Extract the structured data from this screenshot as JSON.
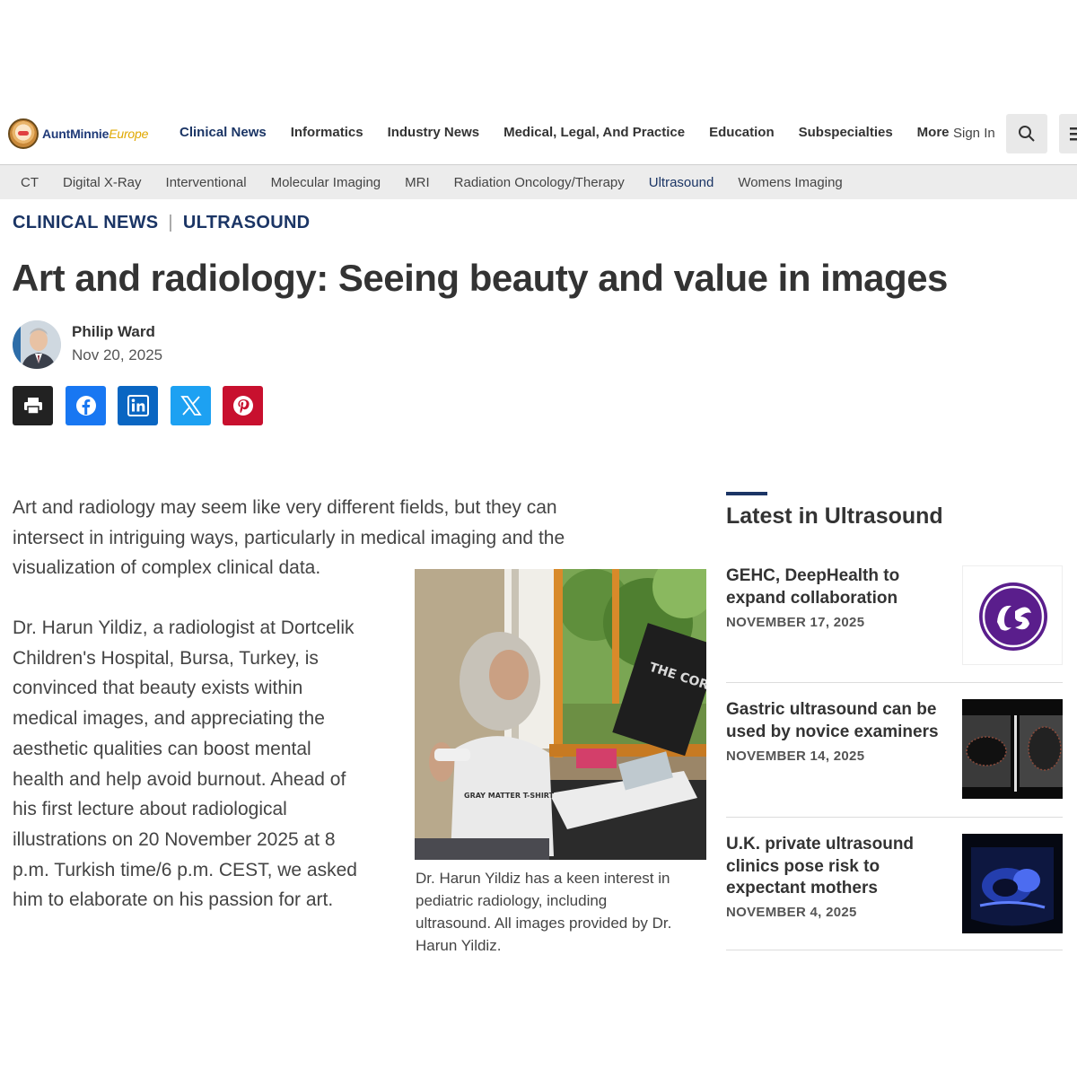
{
  "logo": {
    "brand": "AuntMinnie",
    "region": "Europe"
  },
  "nav": {
    "items": [
      "Clinical News",
      "Informatics",
      "Industry News",
      "Medical, Legal, And Practice",
      "Education",
      "Subspecialties",
      "More"
    ],
    "sign_in": "Sign In"
  },
  "subnav": {
    "items": [
      "CT",
      "Digital X-Ray",
      "Interventional",
      "Molecular Imaging",
      "MRI",
      "Radiation Oncology/Therapy",
      "Ultrasound",
      "Womens Imaging"
    ]
  },
  "breadcrumb": {
    "section": "CLINICAL NEWS",
    "separator": "|",
    "topic": "ULTRASOUND"
  },
  "article": {
    "title": "Art and radiology: Seeing beauty and value in images",
    "author": "Philip Ward",
    "date": "Nov 20, 2025",
    "intro_lines": [
      "Art and radiology may seem like very different fields, but they can",
      "intersect in intriguing ways, particularly in medical imaging and the",
      "visualization of complex clinical data."
    ],
    "para2_lines": [
      "Dr. Harun Yildiz, a radiologist at Dortcelik",
      "Children's Hospital, Bursa, Turkey, is",
      "convinced that beauty exists within",
      "medical images, and appreciating the",
      "aesthetic qualities can boost mental",
      "health and help avoid burnout. Ahead of",
      "his first lecture about radiological",
      "illustrations on 20 November 2025 at 8",
      "p.m. Turkish time/6 p.m. CEST, we asked",
      "him to elaborate on his passion for art."
    ],
    "caption_lines": [
      "Dr. Harun Yildiz has a keen interest in",
      "pediatric radiology, including",
      "ultrasound. All images provided by Dr.",
      "Harun Yildiz."
    ],
    "photo_screen_text": "THE CORTEX CLUB",
    "photo_shirt_text": "GRAY MATTER T-SHIRT"
  },
  "share": {
    "icons": [
      "print-icon",
      "facebook-icon",
      "linkedin-icon",
      "x-icon",
      "pinterest-icon"
    ],
    "colors": {
      "print": "#222222",
      "facebook": "#1877f2",
      "linkedin": "#0a66c2",
      "x": "#1da1f2",
      "pinterest": "#c8102e"
    }
  },
  "sidebar": {
    "title": "Latest in Ultrasound",
    "items": [
      {
        "title_lines": [
          "GEHC, DeepHealth to",
          "expand collaboration"
        ],
        "date": "NOVEMBER 17, 2025",
        "thumb": "ge-logo"
      },
      {
        "title_lines": [
          "Gastric ultrasound can be",
          "used by novice examiners"
        ],
        "date": "NOVEMBER 14, 2025",
        "thumb": "ultrasound-scan"
      },
      {
        "title_lines": [
          "U.K. private ultrasound",
          "clinics pose risk to",
          "expectant mothers"
        ],
        "date": "NOVEMBER 4, 2025",
        "thumb": "fetal-scan"
      }
    ]
  },
  "colors": {
    "brand_navy": "#1b3565",
    "text": "#333333",
    "subnav_bg": "#ececec"
  }
}
